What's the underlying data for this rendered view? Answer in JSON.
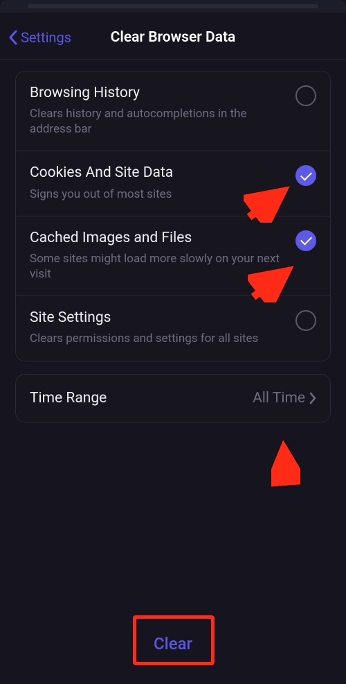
{
  "nav": {
    "back_label": "Settings",
    "title": "Clear Browser Data"
  },
  "options": [
    {
      "title": "Browsing History",
      "subtitle": "Clears history and autocompletions in the address bar",
      "checked": false
    },
    {
      "title": "Cookies And Site Data",
      "subtitle": "Signs you out of most sites",
      "checked": true
    },
    {
      "title": "Cached Images and Files",
      "subtitle": "Some sites might load more slowly on your next visit",
      "checked": true
    },
    {
      "title": "Site Settings",
      "subtitle": "Clears permissions and settings for all sites",
      "checked": false
    }
  ],
  "time_range": {
    "label": "Time Range",
    "value": "All Time"
  },
  "footer": {
    "clear_label": "Clear"
  },
  "annotation": {
    "color": "#ff2b16"
  }
}
